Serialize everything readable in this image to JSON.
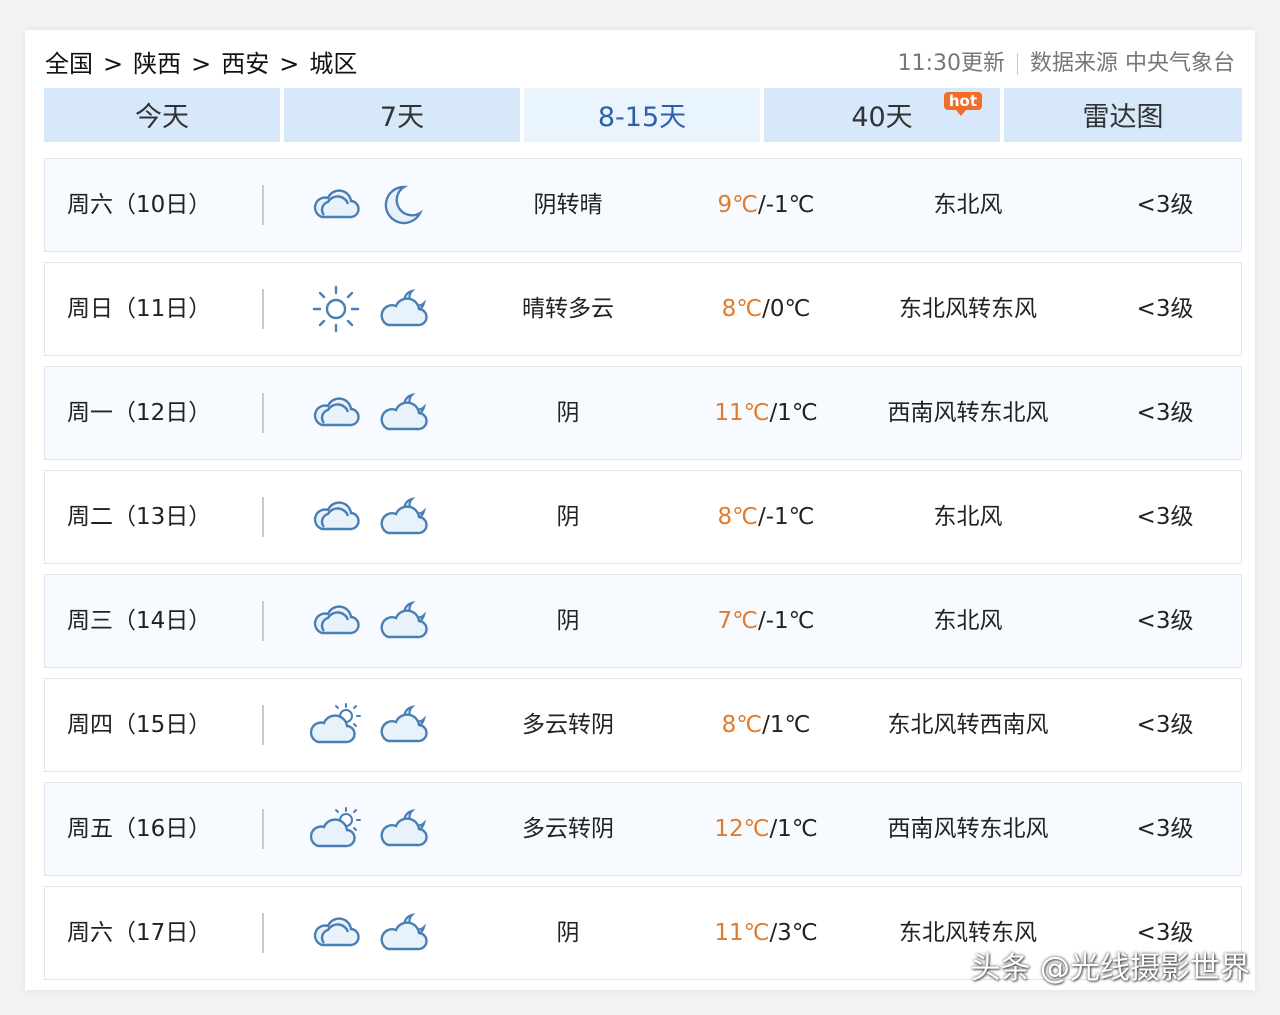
{
  "breadcrumb": [
    "全国",
    "陕西",
    "西安",
    "城区"
  ],
  "breadcrumb_sep": ">",
  "meta": {
    "update_time": "11:30更新",
    "source": "数据来源 中央气象台"
  },
  "tabs": [
    {
      "label": "今天"
    },
    {
      "label": "7天"
    },
    {
      "label": "8-15天"
    },
    {
      "label": "40天",
      "badge": "hot"
    },
    {
      "label": "雷达图"
    }
  ],
  "rows": [
    {
      "day": "周六（10日）",
      "icons": [
        "cloud-icon",
        "moon-icon"
      ],
      "desc": "阴转晴",
      "high": "9℃",
      "low": "/-1℃",
      "wind": "东北风",
      "level": "<3级"
    },
    {
      "day": "周日（11日）",
      "icons": [
        "sun-icon",
        "moon-cloud-icon"
      ],
      "desc": "晴转多云",
      "high": "8℃",
      "low": "/0℃",
      "wind": "东北风转东风",
      "level": "<3级"
    },
    {
      "day": "周一（12日）",
      "icons": [
        "cloud-icon",
        "moon-cloud-icon"
      ],
      "desc": "阴",
      "high": "11℃",
      "low": "/1℃",
      "wind": "西南风转东北风",
      "level": "<3级"
    },
    {
      "day": "周二（13日）",
      "icons": [
        "cloud-icon",
        "moon-cloud-icon"
      ],
      "desc": "阴",
      "high": "8℃",
      "low": "/-1℃",
      "wind": "东北风",
      "level": "<3级"
    },
    {
      "day": "周三（14日）",
      "icons": [
        "cloud-icon",
        "moon-cloud-icon"
      ],
      "desc": "阴",
      "high": "7℃",
      "low": "/-1℃",
      "wind": "东北风",
      "level": "<3级"
    },
    {
      "day": "周四（15日）",
      "icons": [
        "sun-cloud-icon",
        "moon-cloud-icon"
      ],
      "desc": "多云转阴",
      "high": "8℃",
      "low": "/1℃",
      "wind": "东北风转西南风",
      "level": "<3级"
    },
    {
      "day": "周五（16日）",
      "icons": [
        "sun-cloud-icon",
        "moon-cloud-icon"
      ],
      "desc": "多云转阴",
      "high": "12℃",
      "low": "/1℃",
      "wind": "西南风转东北风",
      "level": "<3级"
    },
    {
      "day": "周六（17日）",
      "icons": [
        "cloud-icon",
        "moon-cloud-icon"
      ],
      "desc": "阴",
      "high": "11℃",
      "low": "/3℃",
      "wind": "东北风转东风",
      "level": "<3级"
    }
  ],
  "watermark": "头条 @光线摄影世界",
  "colors": {
    "accent": "#2f5fa8",
    "tab_bg": "#d6e8f9",
    "tab_active_bg": "#eaf4fd",
    "high_temp": "#e07b2c",
    "badge": "#f26d2a"
  }
}
